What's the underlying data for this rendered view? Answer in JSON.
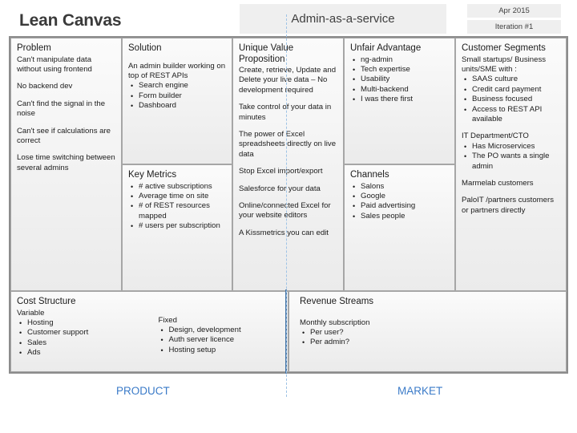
{
  "header": {
    "canvas_title": "Lean Canvas",
    "project_title": "Admin-as-a-service",
    "date": "Apr 2015",
    "iteration": "Iteration #1"
  },
  "colors": {
    "accent_blue": "#3b7bc8",
    "divider_blue": "#9ec3e6",
    "box_border": "#a6a6a6",
    "canvas_border": "#8c8c8c",
    "header_box_bg": "#efefef"
  },
  "canvas": {
    "problem": {
      "title": "Problem",
      "paragraphs": [
        "Can't manipulate data without using frontend",
        "No backend dev",
        "Can't find the signal in the noise",
        "Can't see if calculations are correct",
        "Lose time switching between several admins"
      ]
    },
    "solution": {
      "title": "Solution",
      "intro": "An admin builder working on top of REST APIs",
      "bullets": [
        "Search engine",
        "Form builder",
        "Dashboard"
      ]
    },
    "key_metrics": {
      "title": "Key Metrics",
      "bullets": [
        "# active subscriptions",
        "Average time on site",
        "# of REST resources mapped",
        "# users per subscription"
      ]
    },
    "unique_value_proposition": {
      "title": "Unique Value Proposition",
      "paragraphs": [
        "Create, retrieve, Update and Delete your live data – No development required",
        "Take control of your data in minutes",
        "The power of Excel spreadsheets directly on live data",
        "Stop Excel import/export",
        "Salesforce for your data",
        "Online/connected Excel for your website editors",
        "A Kissmetrics you can edit"
      ]
    },
    "unfair_advantage": {
      "title": "Unfair Advantage",
      "bullets": [
        "ng-admin",
        "Tech expertise",
        "Usability",
        "Multi-backend",
        "I was there first"
      ]
    },
    "channels": {
      "title": "Channels",
      "bullets": [
        "Salons",
        "Google",
        "Paid advertising",
        "Sales people"
      ]
    },
    "customer_segments": {
      "title": "Customer Segments",
      "intro": "Small startups/ Business units/SME with :",
      "bullets_1": [
        "SAAS culture",
        "Credit card payment",
        "Business focused",
        "Access to REST API available"
      ],
      "group_2_label": "IT Department/CTO",
      "bullets_2": [
        "Has Microservices",
        "The PO wants a single admin"
      ],
      "paragraph_1": "Marmelab customers",
      "paragraph_2": "PaloIT /partners customers or partners directly"
    },
    "cost_structure": {
      "title": "Cost Structure",
      "variable_label": "Variable",
      "variable_bullets": [
        "Hosting",
        "Customer support",
        "Sales",
        "Ads"
      ],
      "fixed_label": "Fixed",
      "fixed_bullets": [
        "Design, development",
        "Auth server licence",
        "Hosting setup"
      ]
    },
    "revenue_streams": {
      "title": "Revenue Streams",
      "intro": "Monthly subscription",
      "bullets": [
        "Per user?",
        "Per admin?"
      ]
    }
  },
  "footer": {
    "product_label": "PRODUCT",
    "market_label": "MARKET"
  }
}
